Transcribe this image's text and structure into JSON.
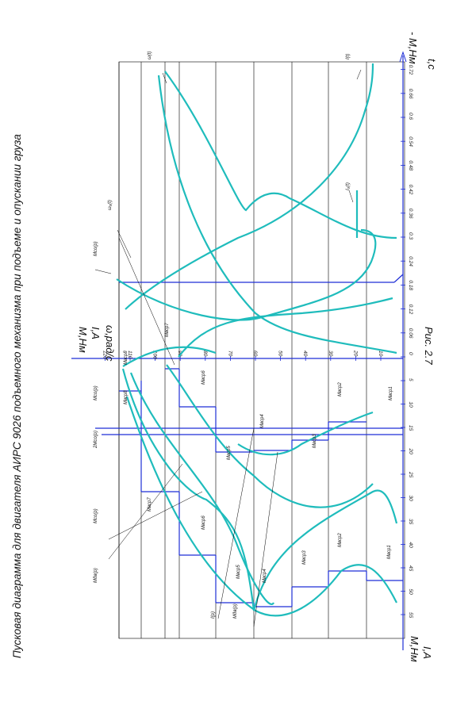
{
  "chart_data": {
    "type": "line",
    "title": "Пусковая диаграмма для двигателя АИРС 9026 подъемного механизма при подъеме и опускании груза",
    "caption": "Рис. 2.7",
    "right_axis": {
      "label_top": "M,Hм",
      "label_mid": "I,A",
      "label_bottom": "ω,рад/с",
      "ticks": [
        10,
        20,
        30,
        40,
        50,
        60,
        70,
        80,
        90,
        100,
        110,
        120
      ]
    },
    "left_axis": {
      "label_top": "M,Hм",
      "label_bottom": "I,A",
      "ticks": [
        5,
        10,
        15,
        20,
        25,
        30,
        35,
        40,
        45,
        50,
        55
      ]
    },
    "time_axis": {
      "label": "- M,Hм",
      "label2": "t,c",
      "ticks": [
        0,
        0.06,
        0.12,
        0.18,
        0.24,
        0.3,
        0.36,
        0.42,
        0.48,
        0.54,
        0.6,
        0.66,
        0.72
      ]
    },
    "annotations": {
      "mco_p_top": "Mco(p)",
      "mco_p_left": "Mco(p)",
      "two_mco_p": "2Mco(p)",
      "mco_p_mid": "Mco(p)",
      "mdv_p": "Mдв(p)",
      "i_p": "I(p)",
      "mdv_p2": "Mдв(p)",
      "omega_t": "ω(t)",
      "omega0_t": "ω₀(t)",
      "i_t": "I(t)",
      "i0_t": "I₀(t)",
      "mbcp1": "Mвср1",
      "mbcp2": "Mвср2",
      "mbcp3": "Mвср3",
      "mbcp4": "Mвср4",
      "mbcp5": "Mвср5",
      "mbcp6": "Mвср6",
      "mbcp7": "Mвср7",
      "mbcp8": "Mвср8",
      "mbcp1_r": "Mвср1",
      "mbcp2_r": "Mвср2",
      "mbcp3_r": "Mвср3",
      "mbcp4_r": "Mвср4",
      "mbcp5_r": "Mвср5",
      "mbcp6_r": "Mвср6",
      "mbcp7_r": "Mвср7",
      "mbcp8_r": "Mвср8"
    },
    "series": [
      {
        "name": "Mдв(p)",
        "color": "#1fbcbc"
      },
      {
        "name": "I(p)",
        "color": "#1fbcbc"
      },
      {
        "name": "ω(t)",
        "color": "#1fbcbc"
      },
      {
        "name": "ω₀(t)",
        "color": "#1fbcbc"
      },
      {
        "name": "I(t)",
        "color": "#1fbcbc"
      },
      {
        "name": "I₀(t)",
        "color": "#1fbcbc"
      }
    ],
    "colors": {
      "curve": "#1fbcbc",
      "steps": "#1f2fd6",
      "grid": "#000000"
    }
  }
}
